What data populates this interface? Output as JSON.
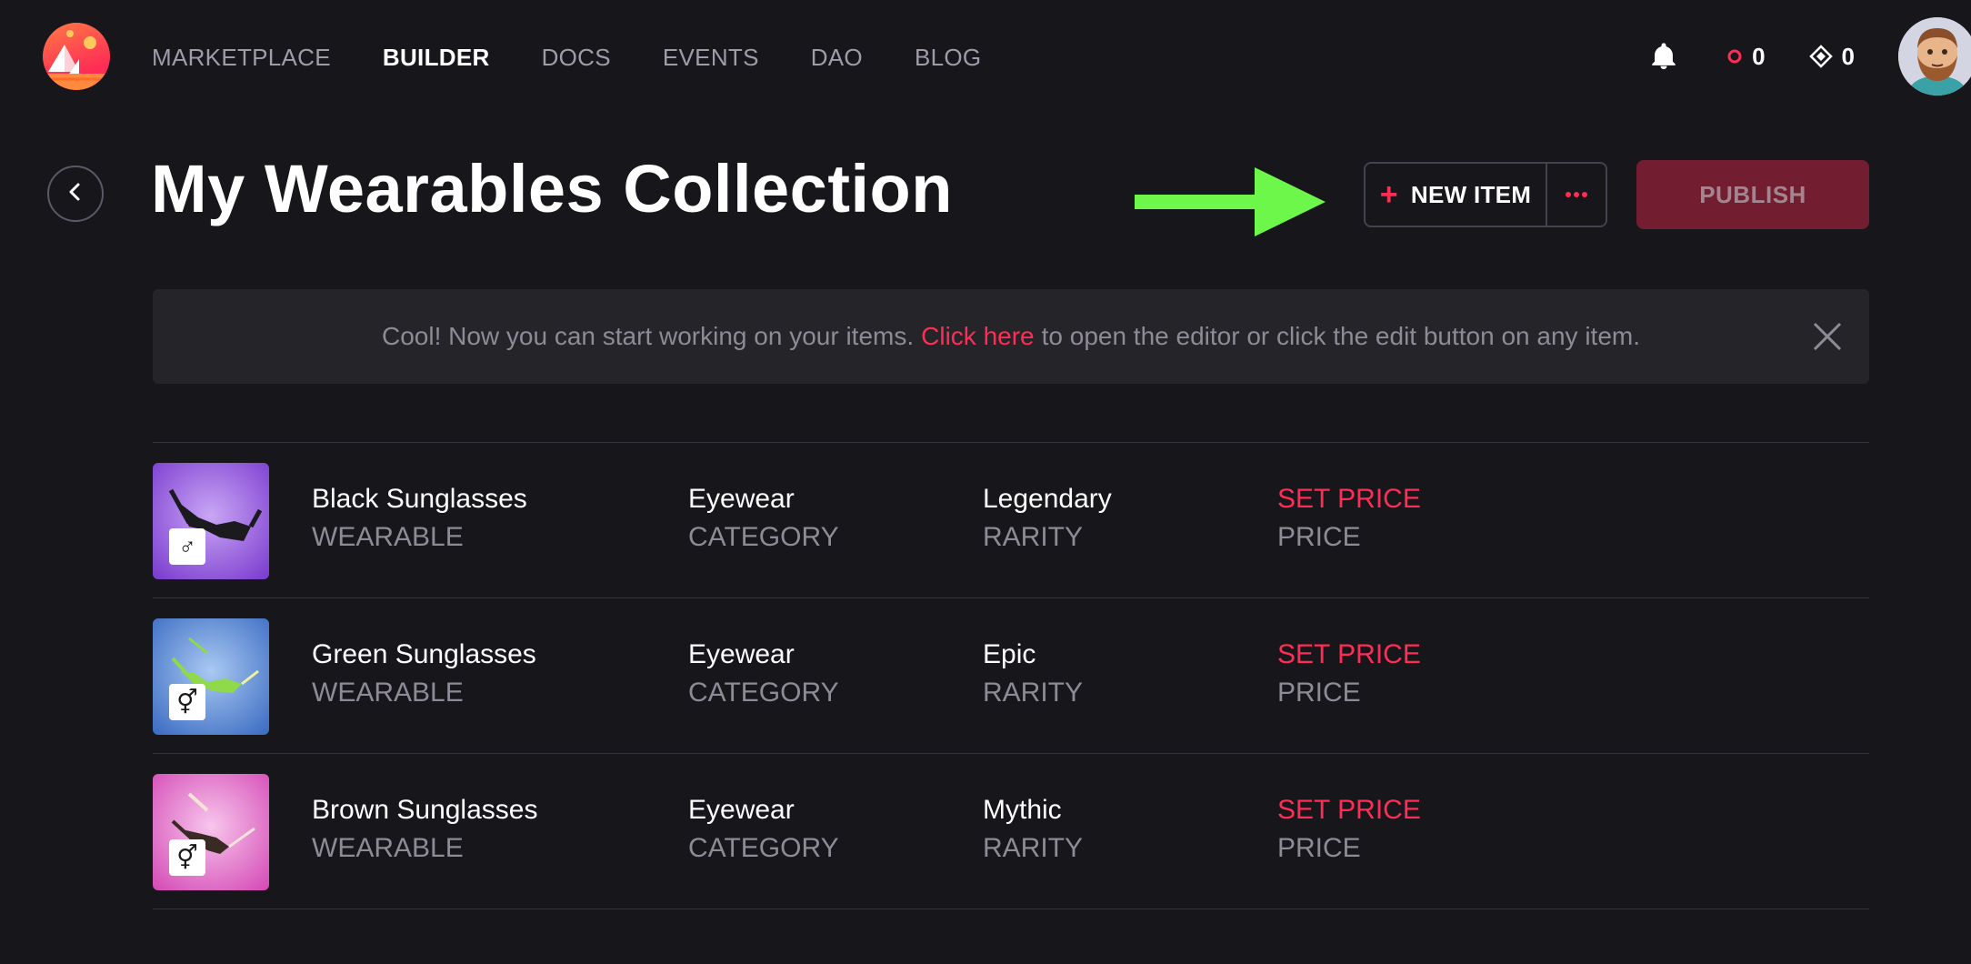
{
  "nav": {
    "items": [
      "Marketplace",
      "Builder",
      "Docs",
      "Events",
      "DAO",
      "Blog"
    ],
    "active": "Builder"
  },
  "balances": {
    "mana_polygon": "0",
    "mana_ethereum": "0"
  },
  "page": {
    "title": "My Wearables Collection",
    "new_item_label": "NEW ITEM",
    "publish_label": "PUBLISH"
  },
  "notice": {
    "before": "Cool! Now you can start working on your items.",
    "link": "Click here",
    "after": "to open the editor or click the edit button on any item."
  },
  "columns": {
    "type": "WEARABLE",
    "category": "CATEGORY",
    "rarity": "RARITY",
    "price": "PRICE"
  },
  "items": [
    {
      "name": "Black Sunglasses",
      "category": "Eyewear",
      "rarity": "Legendary",
      "price": "SET PRICE",
      "gender_icon": "♂︎"
    },
    {
      "name": "Green Sunglasses",
      "category": "Eyewear",
      "rarity": "Epic",
      "price": "SET PRICE",
      "gender_icon": "⚥"
    },
    {
      "name": "Brown Sunglasses",
      "category": "Eyewear",
      "rarity": "Mythic",
      "price": "SET PRICE",
      "gender_icon": "⚥"
    }
  ],
  "colors": {
    "accent": "#ff2d55",
    "background": "#17161b",
    "arrow": "#6cf74a"
  }
}
